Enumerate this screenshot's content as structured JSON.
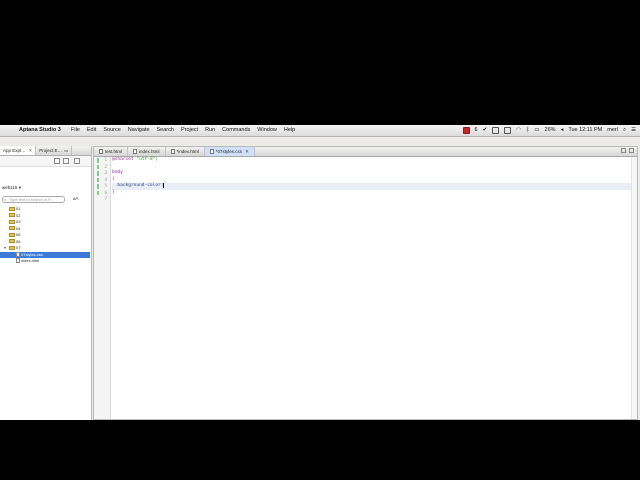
{
  "menubar": {
    "app_name": "Aptana Studio 3",
    "menus": [
      "File",
      "Edit",
      "Source",
      "Navigate",
      "Search",
      "Project",
      "Run",
      "Commands",
      "Window",
      "Help"
    ],
    "battery": "26%",
    "badge": "6",
    "clock": "Tue 12:11 PM",
    "user": "merl"
  },
  "left_panel": {
    "tabs": [
      "App Expl…",
      "Project E…"
    ],
    "project": "web115",
    "filter_placeholder": "Type text to search in P...",
    "aa_label": "aA",
    "tree": [
      {
        "label": "01",
        "type": "folder"
      },
      {
        "label": "02",
        "type": "folder"
      },
      {
        "label": "03",
        "type": "folder"
      },
      {
        "label": "04",
        "type": "folder"
      },
      {
        "label": "05",
        "type": "folder"
      },
      {
        "label": "06",
        "type": "folder"
      },
      {
        "label": "07",
        "type": "folder",
        "expanded": true
      },
      {
        "label": "07styles.css",
        "type": "file",
        "selected": true
      },
      {
        "label": "index.html",
        "type": "file"
      }
    ]
  },
  "editor": {
    "tabs": [
      {
        "label": "test.html",
        "active": false
      },
      {
        "label": "index.html",
        "active": false
      },
      {
        "label": "*index.html",
        "active": false
      },
      {
        "label": "*07styles.css",
        "active": true
      }
    ],
    "line_numbers": [
      "1",
      "2",
      "3",
      "4",
      "5",
      "6",
      "7"
    ],
    "lines": {
      "l1_at": "@charset",
      "l1_str": "\"utf-8\"",
      "l1_end": ";",
      "l3_sel": "body",
      "l4_brace": "{",
      "l5_prop": "background-color:",
      "l6_brace": "}"
    }
  },
  "colors": {
    "accent": "#3d7bd6",
    "active_tab": "#cfe0f8",
    "line_marker": "#7cd37c"
  }
}
